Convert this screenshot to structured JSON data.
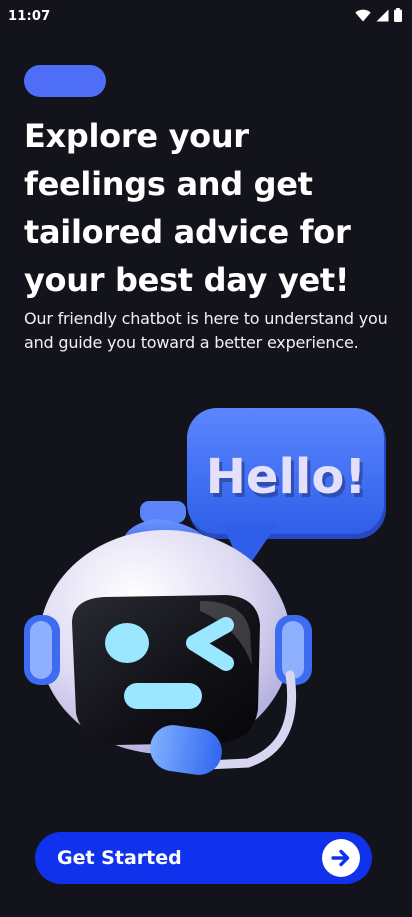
{
  "status_bar": {
    "time": "11:07",
    "icons": [
      "wifi-icon",
      "cell-signal-icon",
      "battery-icon"
    ]
  },
  "headline": "Explore your feelings and get tailored advice for your best day yet!",
  "subtitle": "Our friendly chatbot is here to understand you and guide you toward a better experience.",
  "illustration": {
    "bubble_text": "Hello!",
    "subject": "robot-chatbot-icon"
  },
  "cta": {
    "label": "Get Started",
    "icon": "arrow-right-icon"
  },
  "colors": {
    "background": "#13131b",
    "accent": "#1132ec",
    "pill": "#4f6ef7",
    "bubble": "#3b6df0"
  }
}
